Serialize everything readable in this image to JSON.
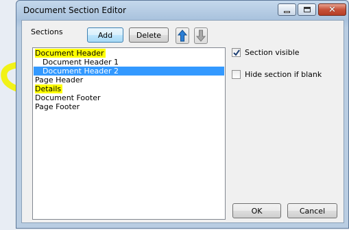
{
  "window": {
    "title": "Document Section Editor"
  },
  "sections_label": "Sections",
  "toolbar": {
    "add_label": "Add",
    "delete_label": "Delete",
    "move_up_icon": "arrow-up-icon",
    "move_down_icon": "arrow-down-icon"
  },
  "sections": [
    {
      "label": "Document Header",
      "indent": false,
      "selected": false,
      "highlighted": true
    },
    {
      "label": "Document Header 1",
      "indent": true,
      "selected": false,
      "highlighted": false
    },
    {
      "label": "Document Header 2",
      "indent": true,
      "selected": true,
      "highlighted": false
    },
    {
      "label": "Page Header",
      "indent": false,
      "selected": false,
      "highlighted": false
    },
    {
      "label": "Details",
      "indent": false,
      "selected": false,
      "highlighted": true
    },
    {
      "label": "Document Footer",
      "indent": false,
      "selected": false,
      "highlighted": false
    },
    {
      "label": "Page Footer",
      "indent": false,
      "selected": false,
      "highlighted": false
    }
  ],
  "options": {
    "section_visible": {
      "label": "Section visible",
      "checked": true
    },
    "hide_if_blank": {
      "label": "Hide section if blank",
      "checked": false
    }
  },
  "buttons": {
    "ok": "OK",
    "cancel": "Cancel"
  },
  "colors": {
    "selection": "#3399ff",
    "highlight": "#ffff00",
    "annotation": "#f2f200"
  }
}
